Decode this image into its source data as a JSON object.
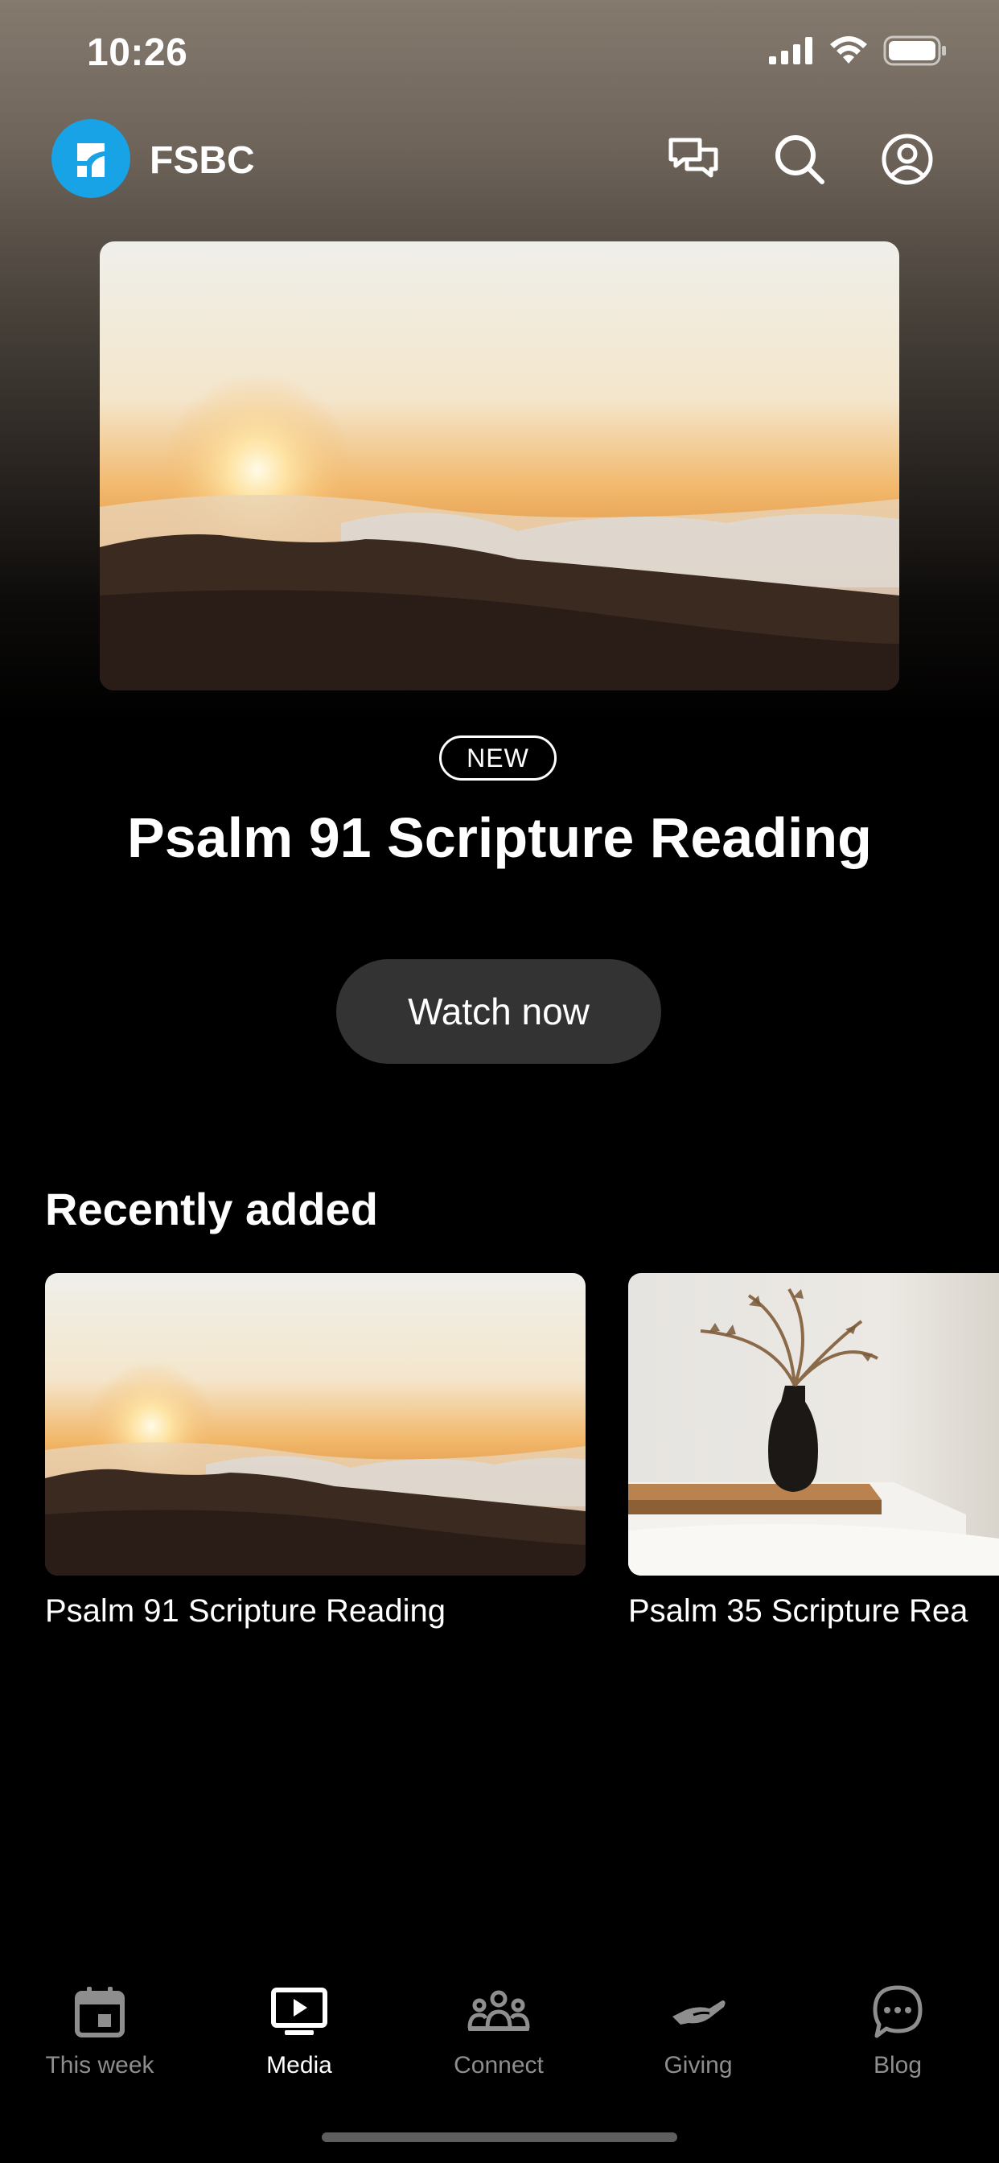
{
  "status_bar": {
    "time": "10:26"
  },
  "header": {
    "app_name": "FSBC",
    "icons": [
      "chat-icon",
      "search-icon",
      "profile-icon"
    ]
  },
  "featured": {
    "badge": "NEW",
    "title": "Psalm 91 Scripture Reading",
    "button_label": "Watch now"
  },
  "recently_added": {
    "heading": "Recently added",
    "items": [
      {
        "title": "Psalm 91 Scripture Reading"
      },
      {
        "title": "Psalm 35 Scripture Rea"
      }
    ]
  },
  "tab_bar": {
    "tabs": [
      {
        "label": "This week",
        "icon": "calendar-icon"
      },
      {
        "label": "Media",
        "icon": "tv-play-icon",
        "active": true
      },
      {
        "label": "Connect",
        "icon": "group-icon"
      },
      {
        "label": "Giving",
        "icon": "hand-icon"
      },
      {
        "label": "Blog",
        "icon": "chat-bubble-icon"
      }
    ]
  },
  "colors": {
    "accent": "#17a3e6",
    "button_bg": "#333333",
    "inactive_tab": "#8e8e8e"
  }
}
